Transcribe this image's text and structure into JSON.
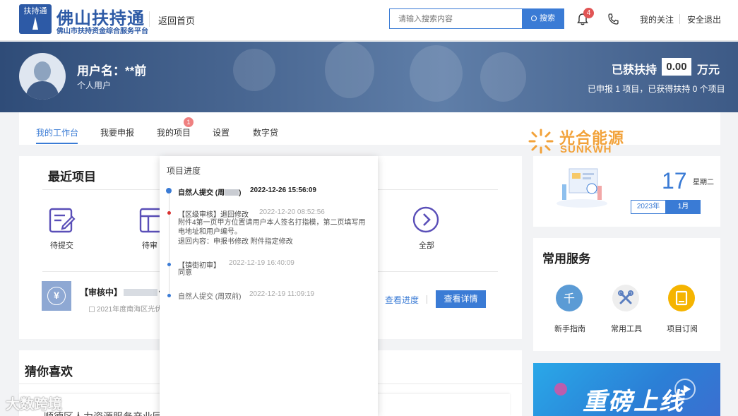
{
  "header": {
    "logo_badge": "扶持通",
    "logo_badge_sub": "佛山",
    "logo_title": "佛山扶持通",
    "logo_subtitle": "佛山市扶持资金综合服务平台",
    "back_home": "返回首页",
    "search_placeholder": "请输入搜索内容",
    "search_button": "搜索",
    "notification_count": "4",
    "my_follow": "我的关注",
    "logout": "安全退出"
  },
  "profile": {
    "username": "用户名：**前",
    "user_type": "个人用户",
    "support_label": "已获扶持",
    "support_amount": "0.00",
    "support_unit": "万元",
    "summary": "已申报 1 项目，已获得扶持 0 个项目"
  },
  "tabs": [
    {
      "label": "我的工作台",
      "active": true
    },
    {
      "label": "我要申报"
    },
    {
      "label": "我的项目",
      "badge": "1"
    },
    {
      "label": "设置"
    },
    {
      "label": "数字贷"
    }
  ],
  "recent": {
    "title": "最近项目",
    "statuses": [
      {
        "label": "待提交",
        "icon": "edit-doc-icon"
      },
      {
        "label": "待审"
      },
      {
        "label": "全部",
        "icon": "chevron-right-circle-icon"
      }
    ],
    "project": {
      "status": "【审核中】",
      "name_visible": "佛山",
      "year_text": "2021年度南海区光伏发",
      "view_progress": "查看进度",
      "view_detail": "查看详情"
    }
  },
  "progress_popup": {
    "title": "项目进度",
    "items": [
      {
        "head": "自然人提交 (周",
        "head_suffix": ")",
        "time": "2022-12-26 15:56:09",
        "body": "",
        "dot_color": "#3a7bd5"
      },
      {
        "head": "【区级审核】退回修改",
        "time": "2022-12-20 08:52:56",
        "body": "附件4第一页甲方位置请用户本人签名打指模，第二页填写用电地址和用户编号。",
        "body2": "退回内容：申报书修改 附件指定修改",
        "dot_color": "#d9302f"
      },
      {
        "head": "【镇街初审】",
        "time": "2022-12-19 16:40:09",
        "body": "同意",
        "dot_color": "#3a7bd5"
      },
      {
        "head": "自然人提交 (周双前)",
        "time": "2022-12-19 11:09:19",
        "body": "",
        "dot_color": "#3a7bd5"
      }
    ]
  },
  "guess": {
    "title": "猜你喜欢",
    "item_text": "顺德区人力资源服务产业园入驻企业 深圳证券交易所 深圳证券交易"
  },
  "brand": {
    "cn": "光合能源",
    "en": "SUNKWH"
  },
  "calendar": {
    "day": "17",
    "weekday": "星期二",
    "year": "2023年",
    "month": "1月"
  },
  "services": {
    "title": "常用服务",
    "items": [
      {
        "label": "新手指南",
        "icon": "guide-icon",
        "color": "#5b9bd5"
      },
      {
        "label": "常用工具",
        "icon": "tools-icon",
        "color": "#eeeeee"
      },
      {
        "label": "项目订阅",
        "icon": "subscribe-icon",
        "color": "#f5b400"
      }
    ]
  },
  "promo": {
    "text": "重磅上线"
  },
  "watermark": "大数跨境"
}
